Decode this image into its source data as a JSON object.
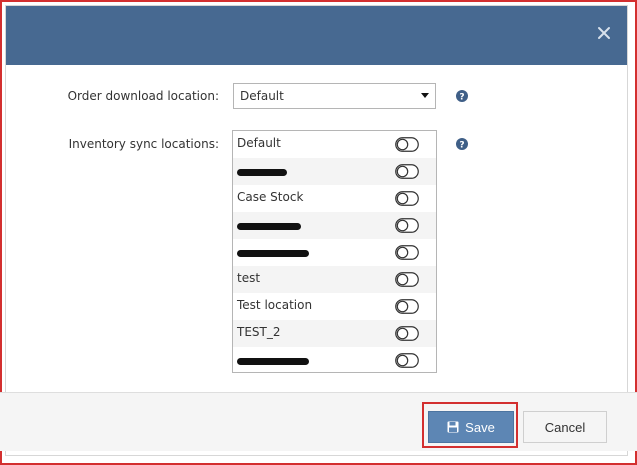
{
  "header": {
    "close_icon": "close-icon"
  },
  "form": {
    "order_download_label": "Order download location:",
    "order_download_value": "Default",
    "inventory_sync_label": "Inventory sync locations:",
    "locations": [
      {
        "name": "Default",
        "redacted": false
      },
      {
        "name": "",
        "redacted": true
      },
      {
        "name": "Case Stock",
        "redacted": false
      },
      {
        "name": "",
        "redacted": true
      },
      {
        "name": "",
        "redacted": true
      },
      {
        "name": "test",
        "redacted": false
      },
      {
        "name": "Test location",
        "redacted": false
      },
      {
        "name": "TEST_2",
        "redacted": false
      },
      {
        "name": "",
        "redacted": true
      }
    ]
  },
  "footer": {
    "save_label": "Save",
    "cancel_label": "Cancel"
  },
  "colors": {
    "header": "#476991",
    "primary": "#5d86b4",
    "highlight": "#d32f2f"
  }
}
